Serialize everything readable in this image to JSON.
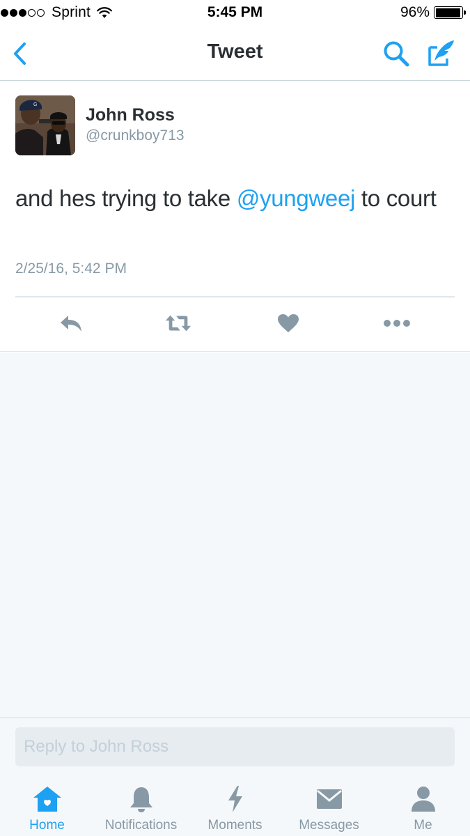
{
  "status_bar": {
    "carrier": "Sprint",
    "signal_bars_filled": 3,
    "signal_bars_total": 5,
    "time": "5:45 PM",
    "battery_percent": "96%",
    "battery_level": 0.96
  },
  "nav": {
    "title": "Tweet",
    "back_icon": "chevron-left-icon",
    "search_icon": "search-icon",
    "compose_icon": "compose-tweet-icon"
  },
  "tweet": {
    "author_name": "John Ross",
    "author_handle": "@crunkboy713",
    "text_before": "and hes trying to take ",
    "mention": "@yungweej",
    "text_after": " to court",
    "timestamp": "2/25/16, 5:42 PM",
    "actions": [
      "reply-icon",
      "retweet-icon",
      "like-icon",
      "more-icon"
    ]
  },
  "reply": {
    "placeholder": "Reply to John Ross",
    "value": ""
  },
  "tabs": [
    {
      "label": "Home",
      "icon": "home-icon",
      "active": true
    },
    {
      "label": "Notifications",
      "icon": "bell-icon",
      "active": false
    },
    {
      "label": "Moments",
      "icon": "lightning-icon",
      "active": false
    },
    {
      "label": "Messages",
      "icon": "envelope-icon",
      "active": false
    },
    {
      "label": "Me",
      "icon": "person-icon",
      "active": false
    }
  ],
  "colors": {
    "accent": "#1da1f2",
    "icon_gray": "#8899a6",
    "text_dark": "#292f33",
    "background_light": "#f5f8fa"
  }
}
